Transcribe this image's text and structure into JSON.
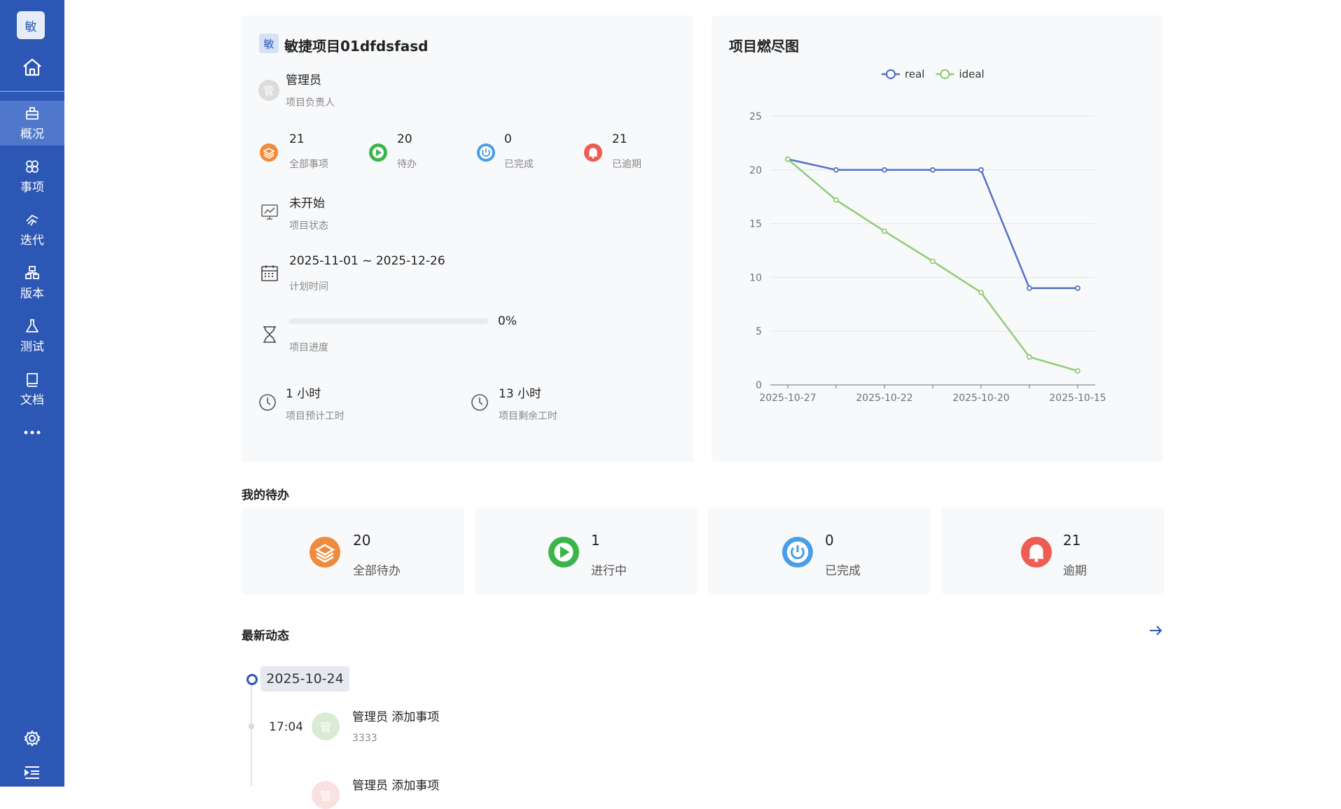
{
  "sidebar": {
    "logo": "敏",
    "items": [
      {
        "label": "概况",
        "icon": "briefcase-icon",
        "active": true
      },
      {
        "label": "事项",
        "icon": "items-icon",
        "active": false
      },
      {
        "label": "迭代",
        "icon": "sprint-icon",
        "active": false
      },
      {
        "label": "版本",
        "icon": "version-icon",
        "active": false
      },
      {
        "label": "测试",
        "icon": "flask-icon",
        "active": false
      },
      {
        "label": "文档",
        "icon": "book-icon",
        "active": false
      }
    ]
  },
  "project": {
    "badge": "敏",
    "name": "敏捷项目01dfdsfasd",
    "owner": {
      "avatar": "管",
      "name": "管理员",
      "label": "项目负责人"
    },
    "stats": [
      {
        "value": "21",
        "label": "全部事项",
        "color": "#f08a3c"
      },
      {
        "value": "20",
        "label": "待办",
        "color": "#3bb54a"
      },
      {
        "value": "0",
        "label": "已完成",
        "color": "#4a9ee8"
      },
      {
        "value": "21",
        "label": "已逾期",
        "color": "#ee5c53"
      }
    ],
    "status": {
      "value": "未开始",
      "label": "项目状态"
    },
    "plan": {
      "value": "2025-11-01 ~ 2025-12-26",
      "label": "计划时间"
    },
    "progress": {
      "percent_text": "0%",
      "fraction": 0,
      "label": "项目进度"
    },
    "estimate": {
      "value": "1 小时",
      "label": "项目预计工时"
    },
    "remaining": {
      "value": "13 小时",
      "label": "项目剩余工时"
    }
  },
  "burndown": {
    "title": "项目燃尽图"
  },
  "chart_data": {
    "type": "line",
    "x": [
      "2025-10-27",
      "",
      "2025-10-22",
      "",
      "2025-10-20",
      "",
      "2025-10-15"
    ],
    "tick_labels": [
      "2025-10-27",
      "2025-10-22",
      "2025-10-20",
      "2025-10-15"
    ],
    "series": [
      {
        "name": "real",
        "color": "#5470c6",
        "values": [
          21,
          20,
          20,
          20,
          20,
          9,
          9
        ]
      },
      {
        "name": "ideal",
        "color": "#91cc75",
        "values": [
          21,
          17.2,
          14.3,
          11.5,
          8.6,
          2.6,
          1.3
        ]
      }
    ],
    "ylim": [
      0,
      25
    ],
    "yticks": [
      0,
      5,
      10,
      15,
      20,
      25
    ],
    "grid": true,
    "legend": "top-center"
  },
  "todo": {
    "title": "我的待办",
    "cards": [
      {
        "value": "20",
        "label": "全部待办",
        "color": "#f08a3c"
      },
      {
        "value": "1",
        "label": "进行中",
        "color": "#3bb54a"
      },
      {
        "value": "0",
        "label": "已完成",
        "color": "#4a9ee8"
      },
      {
        "value": "21",
        "label": "逾期",
        "color": "#ee5c53"
      }
    ]
  },
  "activity": {
    "title": "最新动态",
    "date": "2025-10-24",
    "entries": [
      {
        "time": "17:04",
        "avatar": "管",
        "text": "管理员 添加事项",
        "detail": "3333"
      },
      {
        "time": "",
        "avatar": "管",
        "text": "管理员 添加事项",
        "detail": ""
      }
    ]
  }
}
